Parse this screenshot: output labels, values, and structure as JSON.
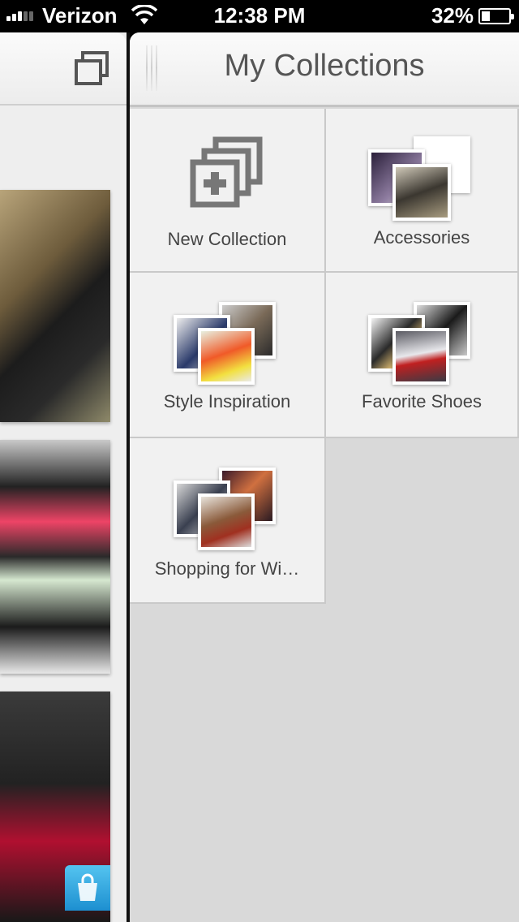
{
  "status_bar": {
    "carrier": "Verizon",
    "time": "12:38 PM",
    "battery": "32%",
    "battery_level": 0.32
  },
  "left_panel": {
    "feed_icon": "collections-icon",
    "shop_icon": "shopping-bag-icon"
  },
  "header": {
    "title": "My Collections",
    "grip_icon": "drag-handle-icon"
  },
  "collections": [
    {
      "name": "New Collection",
      "icon": "add-collection-icon"
    },
    {
      "name": "Accessories"
    },
    {
      "name": "Style Inspiration"
    },
    {
      "name": "Favorite Shoes"
    },
    {
      "name": "Shopping for Wi…"
    }
  ],
  "colors": {
    "header_text": "#555555",
    "tile_bg": "#f1f1f1",
    "panel_bg": "#d9d9d9",
    "shop_badge": "#2a9fd8"
  }
}
